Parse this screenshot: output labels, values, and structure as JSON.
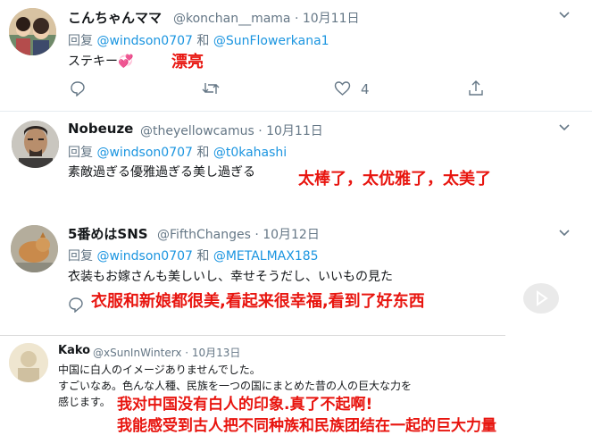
{
  "tweets": [
    {
      "name": "こんちゃんママ",
      "handle": "@konchan__mama · 10月11日",
      "reply_prefix": "回复",
      "mention1": "@windson0707",
      "and": "和",
      "mention2": "@SunFlowerkana1",
      "text": "ステキー",
      "heart_emoji": "💞",
      "translation": "漂亮",
      "likes": "4"
    },
    {
      "name": "Nobeuze",
      "handle": "@theyellowcamus · 10月11日",
      "reply_prefix": "回复",
      "mention1": "@windson0707",
      "and": "和",
      "mention2": "@t0kahashi",
      "text": "素敵過ぎる優雅過ぎる美し過ぎる",
      "translation": "太棒了，太优雅了，太美了"
    },
    {
      "name": "5番めはSNS",
      "handle": "@FifthChanges · 10月12日",
      "reply_prefix": "回复",
      "mention1": "@windson0707",
      "and": "和",
      "mention2": "@METALMAX185",
      "text": "衣装もお嫁さんも美しいし、幸せそうだし、いいもの見た",
      "translation": "衣服和新娘都很美,看起来很幸福,看到了好东西"
    },
    {
      "name": "Kako",
      "handle": "@xSunInWinterx · 10月13日",
      "text_line1": "中国に白人のイメージありませんでした。",
      "text_line2": "すごいなあ。色んな人種、民族を一つの国にまとめた昔の人の巨大な力を",
      "text_line3": "感じます。",
      "translation_line1": "我对中国没有白人的印象.真了不起啊!",
      "translation_line2": "我能感受到古人把不同种族和民族团结在一起的巨大力量"
    }
  ]
}
